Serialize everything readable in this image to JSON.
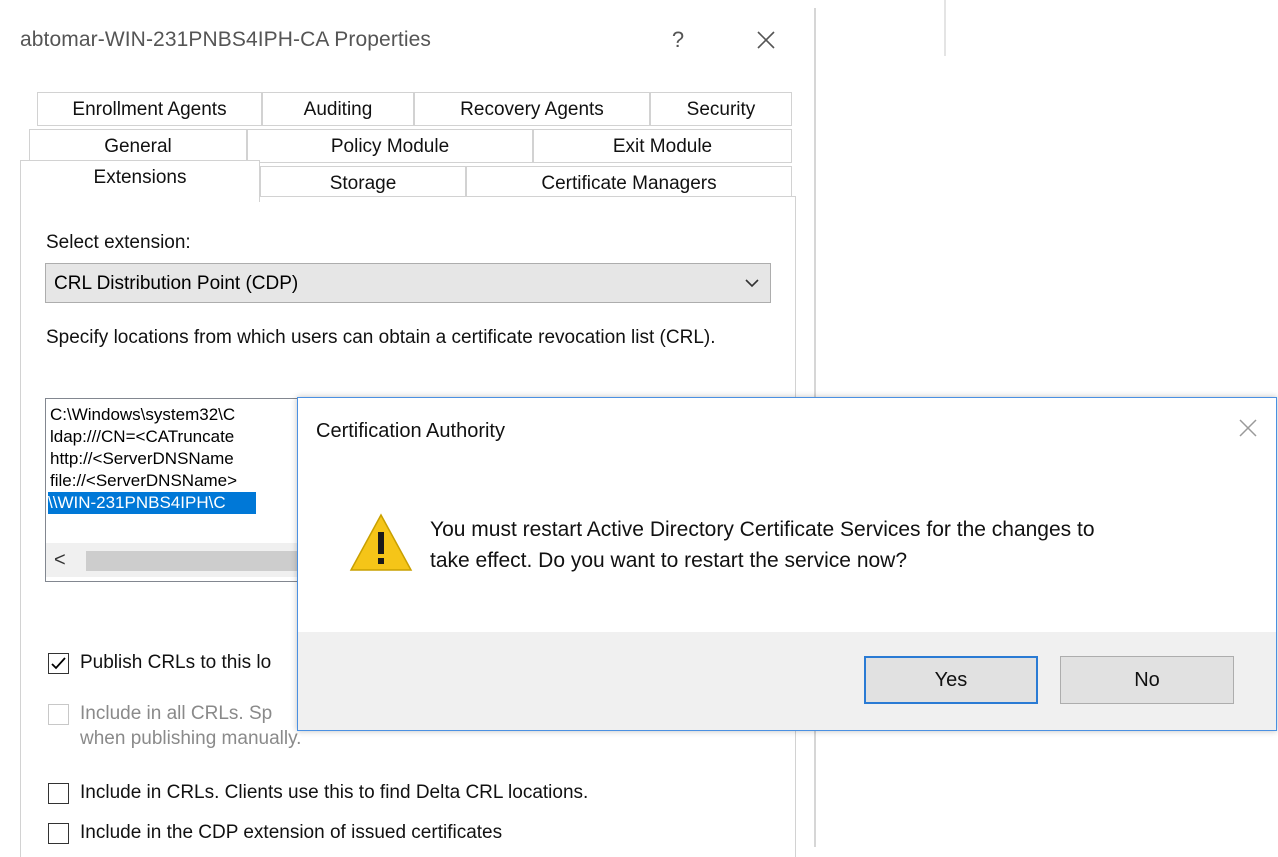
{
  "properties_window": {
    "title": "abtomar-WIN-231PNBS4IPH-CA Properties",
    "help_glyph": "?",
    "tabs_row1": [
      "Enrollment Agents",
      "Auditing",
      "Recovery Agents",
      "Security"
    ],
    "tabs_row2": [
      "General",
      "Policy Module",
      "Exit Module"
    ],
    "tabs_row3": [
      "Extensions",
      "Storage",
      "Certificate Managers"
    ],
    "active_tab": "Extensions",
    "select_extension_label": "Select extension:",
    "selected_extension": "CRL Distribution Point (CDP)",
    "locations_description": "Specify locations from which users can obtain a certificate revocation list (CRL).",
    "locations": [
      "C:\\Windows\\system32\\C",
      "ldap:///CN=<CATruncate",
      "http://<ServerDNSName",
      "file://<ServerDNSName>",
      "\\\\WIN-231PNBS4IPH\\C"
    ],
    "selected_location_index": 4,
    "scroll_left_glyph": "<",
    "options": [
      {
        "label": "Publish CRLs to this lo",
        "checked": true,
        "enabled": true
      },
      {
        "label": "Include in all CRLs. Sp",
        "label_line2": "when publishing manually.",
        "checked": false,
        "enabled": false
      },
      {
        "label": "Include in CRLs. Clients use this to find Delta CRL locations.",
        "checked": false,
        "enabled": true
      },
      {
        "label": "Include in the CDP extension of issued certificates",
        "checked": false,
        "enabled": true
      }
    ]
  },
  "dialog": {
    "title": "Certification Authority",
    "icon": "warning-icon",
    "message_line1": "You must restart Active Directory Certificate Services for the changes to",
    "message_line2": "take effect. Do you want to restart the service now?",
    "yes_label": "Yes",
    "no_label": "No",
    "default_button": "Yes"
  },
  "colors": {
    "selection": "#0078d7",
    "dialog_border": "#4a90e2",
    "default_button_border": "#2a7bd4",
    "warning_fill": "#f5c518"
  }
}
